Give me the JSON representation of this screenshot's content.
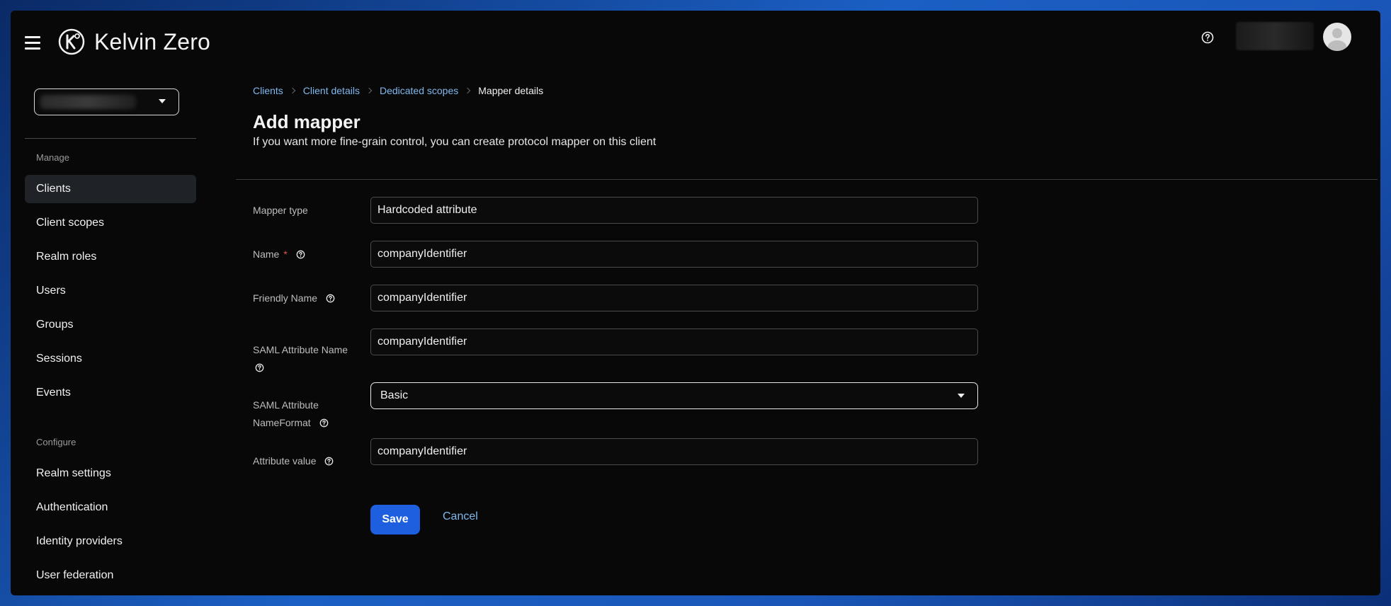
{
  "header": {
    "brand": "Kelvin Zero"
  },
  "sidebar": {
    "manage_label": "Manage",
    "configure_label": "Configure",
    "manage_items": [
      {
        "label": "Clients"
      },
      {
        "label": "Client scopes"
      },
      {
        "label": "Realm roles"
      },
      {
        "label": "Users"
      },
      {
        "label": "Groups"
      },
      {
        "label": "Sessions"
      },
      {
        "label": "Events"
      }
    ],
    "configure_items": [
      {
        "label": "Realm settings"
      },
      {
        "label": "Authentication"
      },
      {
        "label": "Identity providers"
      },
      {
        "label": "User federation"
      }
    ]
  },
  "breadcrumb": [
    "Clients",
    "Client details",
    "Dedicated scopes",
    "Mapper details"
  ],
  "page": {
    "title": "Add mapper",
    "subtitle": "If you want more fine-grain control, you can create protocol mapper on this client"
  },
  "form": {
    "mapper_type": {
      "label": "Mapper type",
      "value": "Hardcoded attribute"
    },
    "name": {
      "label": "Name",
      "required_mark": "*",
      "value": "companyIdentifier"
    },
    "friendly_name": {
      "label": "Friendly Name",
      "value": "companyIdentifier"
    },
    "saml_attribute_name": {
      "label": "SAML Attribute Name",
      "value": "companyIdentifier"
    },
    "saml_name_format": {
      "label_line1": "SAML Attribute",
      "label_line2": "NameFormat",
      "value": "Basic"
    },
    "attribute_value": {
      "label": "Attribute value",
      "value": "companyIdentifier"
    }
  },
  "actions": {
    "save": "Save",
    "cancel": "Cancel"
  },
  "colors": {
    "accent": "#1e5fe0",
    "link": "#7fb8ee",
    "required": "#e05252"
  }
}
